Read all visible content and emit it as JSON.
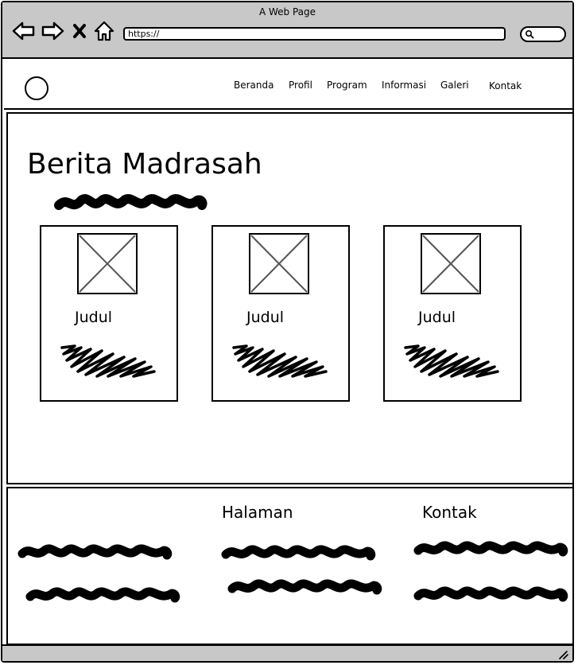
{
  "browser": {
    "window_title": "A Web Page",
    "url": "https://",
    "icons": {
      "back": "back-arrow-icon",
      "forward": "forward-arrow-icon",
      "stop": "close-x-icon",
      "home": "home-icon",
      "search": "search-icon"
    }
  },
  "nav": {
    "items": [
      "Beranda",
      "Profil",
      "Program",
      "Informasi",
      "Galeri",
      "Kontak"
    ]
  },
  "main": {
    "title": "Berita Madrasah",
    "cards": [
      {
        "title": "Judul"
      },
      {
        "title": "Judul"
      },
      {
        "title": "Judul"
      }
    ]
  },
  "footer": {
    "headings": [
      "Halaman",
      "Kontak"
    ]
  },
  "colors": {
    "chrome": "#c8c8c8",
    "ink": "#000000",
    "placeholder_x": "#555555"
  }
}
